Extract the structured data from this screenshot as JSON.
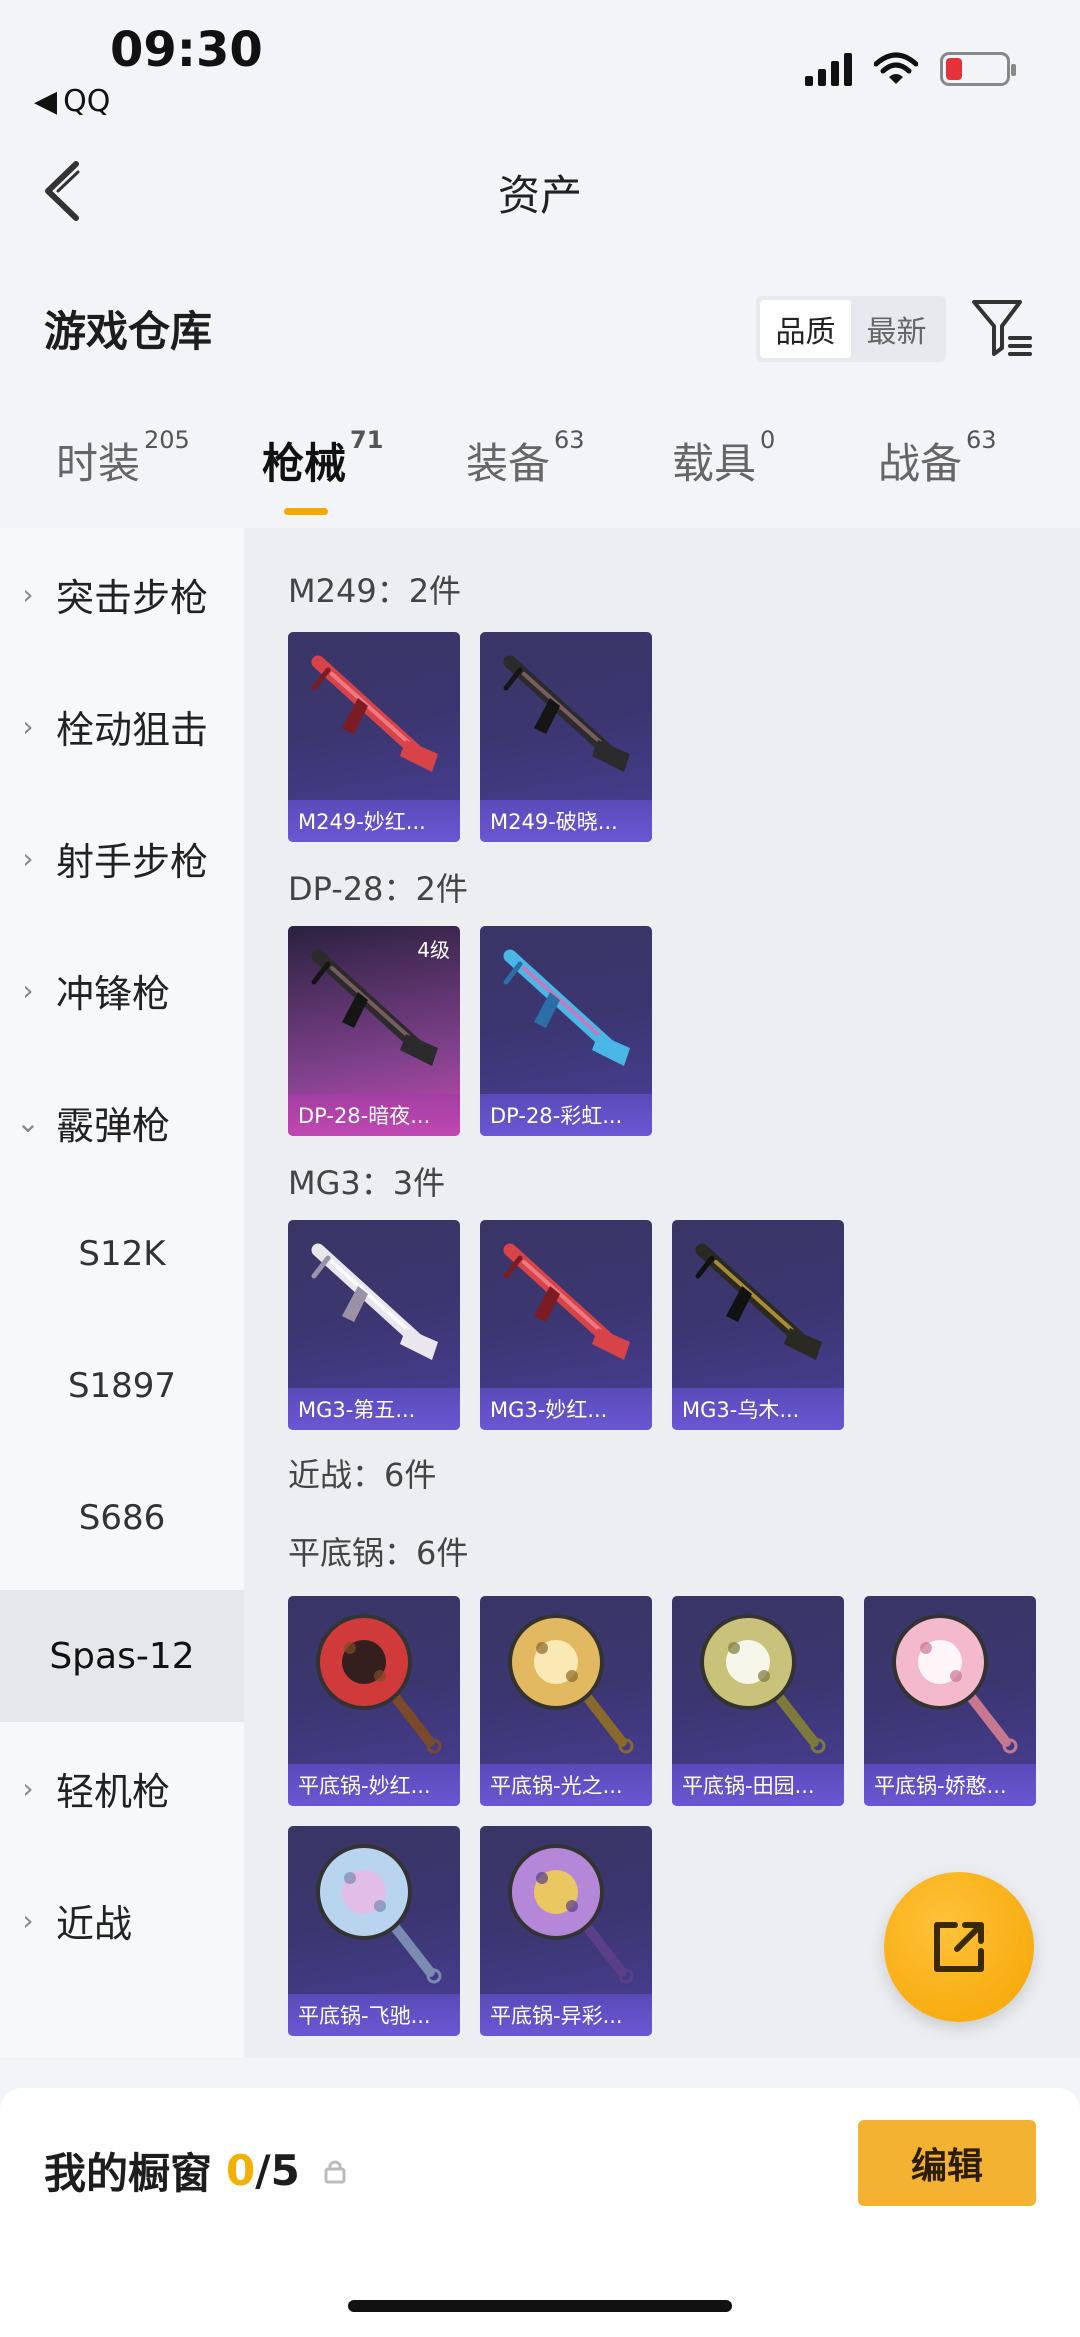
{
  "status": {
    "time": "09:30",
    "back_app": "QQ"
  },
  "header": {
    "title": "资产"
  },
  "section": {
    "title": "游戏仓库",
    "sort_options": [
      "品质",
      "最新"
    ],
    "sort_selected": "品质"
  },
  "tabs": [
    {
      "label": "时装",
      "count": "205"
    },
    {
      "label": "枪械",
      "count": "71",
      "active": true
    },
    {
      "label": "装备",
      "count": "63"
    },
    {
      "label": "载具",
      "count": "0"
    },
    {
      "label": "战备",
      "count": "63"
    }
  ],
  "sidebar": [
    {
      "label": "突击步枪",
      "type": "category"
    },
    {
      "label": "栓动狙击",
      "type": "category"
    },
    {
      "label": "射手步枪",
      "type": "category"
    },
    {
      "label": "冲锋枪",
      "type": "category"
    },
    {
      "label": "霰弹枪",
      "type": "category-open"
    },
    {
      "label": "S12K",
      "type": "sub"
    },
    {
      "label": "S1897",
      "type": "sub"
    },
    {
      "label": "S686",
      "type": "sub"
    },
    {
      "label": "Spas-12",
      "type": "selected"
    },
    {
      "label": "轻机枪",
      "type": "category"
    },
    {
      "label": "近战",
      "type": "category"
    }
  ],
  "groups": [
    {
      "label": "M249：2件",
      "items": [
        {
          "name": "M249-妙红...",
          "art": "gun-red"
        },
        {
          "name": "M249-破晓...",
          "art": "gun-dark"
        }
      ]
    },
    {
      "label": "DP-28：2件",
      "items": [
        {
          "name": "DP-28-暗夜...",
          "art": "gun-dark",
          "tier": "4级",
          "rarity": "pink"
        },
        {
          "name": "DP-28-彩虹...",
          "art": "gun-rainbow"
        }
      ]
    },
    {
      "label": "MG3：3件",
      "items": [
        {
          "name": "MG3-第五...",
          "art": "gun-white"
        },
        {
          "name": "MG3-妙红...",
          "art": "gun-red"
        },
        {
          "name": "MG3-乌木...",
          "art": "gun-gold"
        }
      ]
    },
    {
      "label": "近战：6件",
      "items": []
    },
    {
      "label": "平底锅：6件",
      "items": [
        {
          "name": "平底锅-妙红...",
          "art": "pan-red"
        },
        {
          "name": "平底锅-光之...",
          "art": "pan-gold"
        },
        {
          "name": "平底锅-田园...",
          "art": "pan-green"
        },
        {
          "name": "平底锅-娇憨...",
          "art": "pan-pink"
        },
        {
          "name": "平底锅-飞驰...",
          "art": "pan-blue"
        },
        {
          "name": "平底锅-异彩...",
          "art": "pan-purple"
        }
      ]
    }
  ],
  "showcase": {
    "label": "我的橱窗",
    "used": "0",
    "total": "/5"
  },
  "edit_button": "编辑",
  "colors": {
    "accent": "#f2a900",
    "card_top": "#3a3566",
    "card_caption": "#6b57d4",
    "rare_pink": "#c54bb0"
  },
  "icons": [
    "back-arrow-icon",
    "filter-icon",
    "share-icon",
    "lock-icon",
    "chevron-right-icon",
    "chevron-down-icon"
  ]
}
